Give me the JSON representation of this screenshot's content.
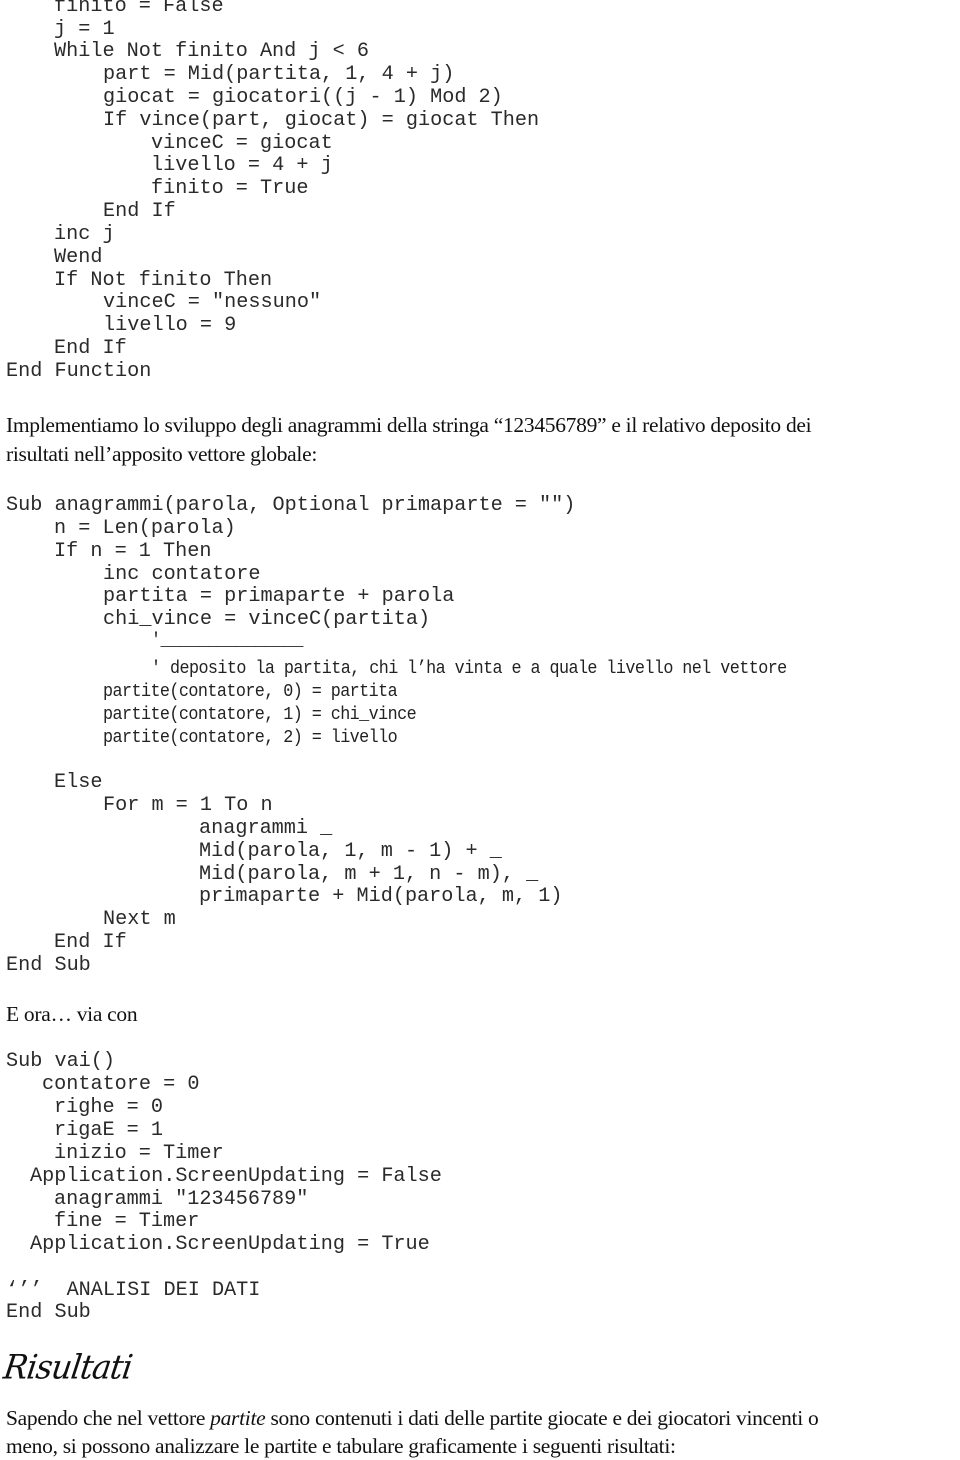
{
  "block1": {
    "lines": [
      {
        "indent": 4,
        "text": "finito = False"
      },
      {
        "indent": 4,
        "text": "j = 1"
      },
      {
        "indent": 4,
        "text": "While Not finito And j < 6"
      },
      {
        "indent": 8,
        "text": "part = Mid(partita, 1, 4 + j)"
      },
      {
        "indent": 8,
        "text": "giocat = giocatori((j - 1) Mod 2)"
      },
      {
        "indent": 8,
        "text": "If vince(part, giocat) = giocat Then"
      },
      {
        "indent": 12,
        "text": "vinceC = giocat"
      },
      {
        "indent": 12,
        "text": "livello = 4 + j"
      },
      {
        "indent": 12,
        "text": "finito = True"
      },
      {
        "indent": 8,
        "text": "End If"
      },
      {
        "indent": 4,
        "text": "inc j"
      },
      {
        "indent": 4,
        "text": "Wend"
      },
      {
        "indent": 4,
        "text": "If Not finito Then"
      },
      {
        "indent": 8,
        "text": "vinceC = \"nessuno\""
      },
      {
        "indent": 8,
        "text": "livello = 9"
      },
      {
        "indent": 4,
        "text": "End If"
      },
      {
        "indent": 0,
        "text": "End Function"
      }
    ]
  },
  "paragraph1": {
    "line1": "Implementiamo lo sviluppo degli anagrammi della stringa “123456789” e il relativo deposito dei",
    "line2": "risultati nell’apposito vettore globale:"
  },
  "block2": {
    "lines": [
      {
        "indent": 0,
        "text": "Sub anagrammi(parola, Optional primaparte = \"\")",
        "style": "normal"
      },
      {
        "indent": 4,
        "text": "n = Len(parola)",
        "style": "normal"
      },
      {
        "indent": 4,
        "text": "If n = 1 Then",
        "style": "normal"
      },
      {
        "indent": 8,
        "text": "inc contatore",
        "style": "normal"
      },
      {
        "indent": 8,
        "text": "partita = primaparte + parola",
        "style": "normal"
      },
      {
        "indent": 8,
        "text": "chi_vince = vinceC(partita)",
        "style": "normal"
      },
      {
        "indent": 12,
        "text": "'_______________",
        "style": "narrow"
      },
      {
        "indent": 12,
        "text": "' deposito la partita, chi l’ha vinta e a quale livello nel vettore",
        "style": "narrow"
      },
      {
        "indent": 8,
        "text": "partite(contatore, 0) = partita",
        "style": "narrow"
      },
      {
        "indent": 8,
        "text": "partite(contatore, 1) = chi_vince",
        "style": "narrow"
      },
      {
        "indent": 8,
        "text": "partite(contatore, 2) = livello",
        "style": "narrow"
      },
      {
        "indent": 4,
        "text": "Else",
        "style": "normal"
      },
      {
        "indent": 8,
        "text": "For m = 1 To n",
        "style": "normal"
      },
      {
        "indent": 16,
        "text": "anagrammi _",
        "style": "normal"
      },
      {
        "indent": 16,
        "text": "Mid(parola, 1, m - 1) + _",
        "style": "normal"
      },
      {
        "indent": 16,
        "text": "Mid(parola, m + 1, n - m), _",
        "style": "normal"
      },
      {
        "indent": 16,
        "text": "primaparte + Mid(parola, m, 1)",
        "style": "normal"
      },
      {
        "indent": 8,
        "text": "Next m",
        "style": "normal"
      },
      {
        "indent": 4,
        "text": "End If",
        "style": "normal"
      },
      {
        "indent": 0,
        "text": "End Sub",
        "style": "normal"
      }
    ]
  },
  "paragraph2": {
    "text": "E ora… via con"
  },
  "block3": {
    "lines": [
      {
        "indent": 0,
        "text": "Sub vai()"
      },
      {
        "indent": 3,
        "text": "contatore = 0"
      },
      {
        "indent": 4,
        "text": "righe = 0"
      },
      {
        "indent": 4,
        "text": "rigaE = 1"
      },
      {
        "indent": 4,
        "text": "inizio = Timer"
      },
      {
        "indent": 2,
        "text": "Application.ScreenUpdating = False"
      },
      {
        "indent": 4,
        "text": "anagrammi \"123456789\""
      },
      {
        "indent": 4,
        "text": "fine = Timer"
      },
      {
        "indent": 2,
        "text": "Application.ScreenUpdating = True"
      },
      {
        "indent": 0,
        "text": "‘’’  ANALISI DEI DATI"
      },
      {
        "indent": 0,
        "text": "End Sub"
      }
    ]
  },
  "section_heading": {
    "text": "Risultati"
  },
  "paragraph3": {
    "line1_before": "Sapendo che nel vettore ",
    "line1_italic": "partite",
    "line1_after": " sono contenuti i dati delle partite giocate e dei giocatori vincenti o",
    "line2": "meno, si possono analizzare le partite e tabulare graficamente i seguenti risultati:"
  }
}
